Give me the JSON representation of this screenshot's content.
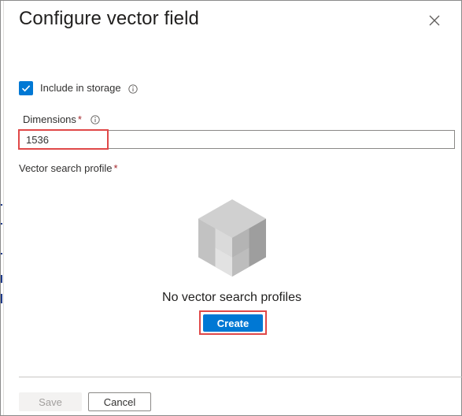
{
  "dialog": {
    "title": "Configure vector field",
    "close_icon": "close-icon"
  },
  "storage": {
    "checked": true,
    "label": "Include in storage",
    "info_icon": "info-icon"
  },
  "dimensions": {
    "label": "Dimensions",
    "required_mark": "*",
    "info_icon": "info-icon",
    "value": "1536"
  },
  "vector_search_profile": {
    "label": "Vector search profile",
    "required_mark": "*",
    "empty_icon": "cube-icon",
    "empty_message": "No vector search profiles",
    "create_label": "Create"
  },
  "footer": {
    "save_label": "Save",
    "cancel_label": "Cancel"
  },
  "colors": {
    "accent": "#0078d4",
    "highlight": "#e04848",
    "required": "#a4262c"
  }
}
